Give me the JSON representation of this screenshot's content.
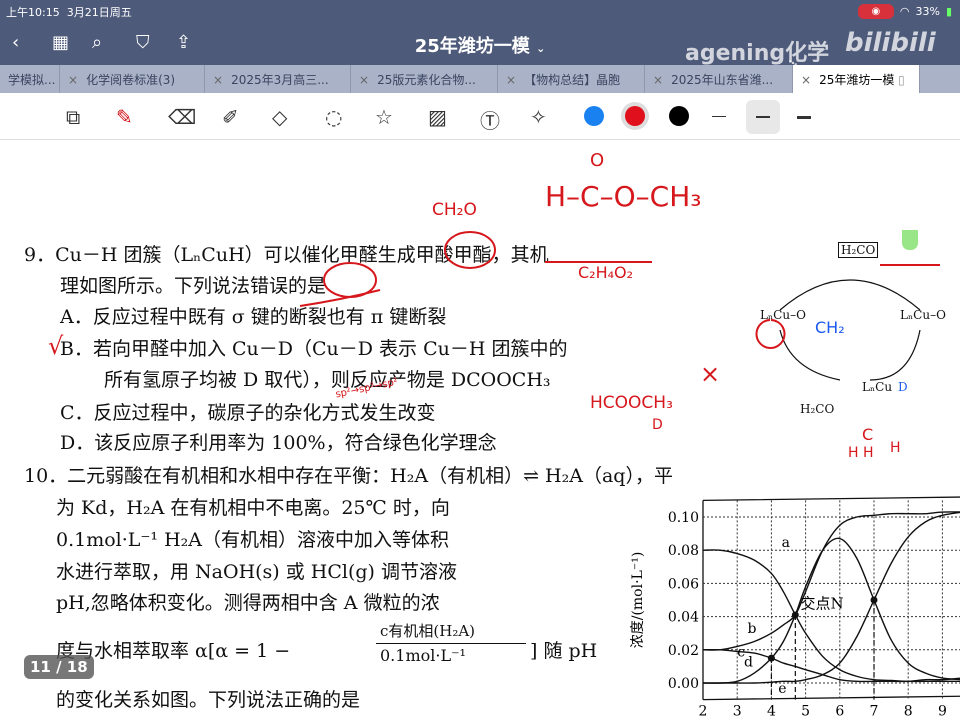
{
  "status": {
    "time": "上午10:15",
    "date": "3月21日周五",
    "battery": "33%"
  },
  "nav": {
    "title": "25年潍坊一模",
    "watermark": "ageningֻ化学",
    "watermark2": "bilibili"
  },
  "tabs": [
    {
      "label": "学模拟..."
    },
    {
      "label": "化学阅卷标准(3)"
    },
    {
      "label": "2025年3月高三..."
    },
    {
      "label": "25版元素化合物..."
    },
    {
      "label": "【物构总结】晶胞"
    },
    {
      "label": "2025年山东省潍..."
    },
    {
      "label": "25年潍坊一模"
    }
  ],
  "toolbar": {
    "colors": [
      "#1a82f0",
      "#e0101c",
      "#000000"
    ]
  },
  "doc": {
    "q9": [
      "9．Cu－H 团簇（LₙCuH）可以催化甲醛生成甲酸甲酯，其机",
      "理如图所示。下列说法错误的是"
    ],
    "q9A": "A．反应过程中既有 σ 键的断裂也有 π 键断裂",
    "q9B": [
      "B．若向甲醛中加入 Cu－D（Cu－D 表示 Cu－H 团簇中的",
      "所有氢原子均被 D 取代），则反应产物是 DCOOCH₃"
    ],
    "q9C": "C．反应过程中，碳原子的杂化方式发生改变",
    "q9D": "D．该反应原子利用率为 100%，符合绿色化学理念",
    "q10": [
      "10．二元弱酸在有机相和水相中存在平衡：H₂A（有机相）⇌ H₂A（aq），平",
      "为 Kd，H₂A 在有机相中不电离。25℃ 时，向",
      "0.1mol·L⁻¹ H₂A（有机相）溶液中加入等体积",
      "水进行萃取，用 NaOH(s) 或 HCl(g) 调节溶液",
      "pH,忽略体积变化。测得两相中含 A 微粒的浓",
      "度与水相萃取率 α[α = 1 −",
      "c有机相(H₂A)",
      "0.1mol·L⁻¹",
      "] 随 pH",
      "的变化关系如图。下列说法正确的是"
    ],
    "mech": [
      "H₂CO",
      "LₙCu–O",
      "LₙCu–O",
      "LₙCu",
      "H₂CO",
      "D"
    ],
    "page": "11 / 18"
  },
  "annotations": [
    "CH₂O",
    "H–C–O–CH₃",
    "C₂H₄O₂",
    "HCOOCH₃",
    "sp²→sp³→sp²",
    "CH₂",
    "D",
    "H",
    "O",
    "C",
    "H  H",
    "×",
    "√"
  ],
  "chart_data": {
    "type": "line",
    "xlabel": "",
    "ylabel": "浓度/(mol·L⁻¹)",
    "xlim": [
      2,
      9.6
    ],
    "ylim": [
      -0.01,
      0.11
    ],
    "xticks": [
      "2",
      "3",
      "4",
      "5",
      "6",
      "7",
      "8",
      "9"
    ],
    "yticks": [
      "0.10",
      "0.08",
      "0.06",
      "0.04",
      "0.02",
      "0.00"
    ],
    "grid": true,
    "x": [
      2,
      2.5,
      3,
      3.5,
      4,
      4.35,
      4.7,
      5,
      5.5,
      6,
      6.5,
      7,
      7.5,
      8,
      8.5,
      9,
      9.6
    ],
    "series": [
      {
        "name": "a",
        "values": [
          0.08,
          0.08,
          0.078,
          0.074,
          0.066,
          0.055,
          0.041,
          0.03,
          0.016,
          0.008,
          0.004,
          0.002,
          0.0015,
          0.001,
          0.001,
          0.001,
          0.001
        ]
      },
      {
        "name": "b",
        "values": [
          0.02,
          0.02,
          0.022,
          0.025,
          0.03,
          0.035,
          0.041,
          0.055,
          0.08,
          0.095,
          0.1,
          0.101,
          0.102,
          0.102,
          0.102,
          0.103,
          0.103
        ]
      },
      {
        "name": "c",
        "values": [
          0.02,
          0.02,
          0.019,
          0.018,
          0.015,
          0.012,
          0.01,
          0.008,
          0.005,
          0.002,
          0.001,
          0.001,
          0.001,
          0.001,
          0.002,
          0.002,
          0.003
        ]
      },
      {
        "name": "d",
        "values": [
          0,
          0,
          0.001,
          0.006,
          0.015,
          0.025,
          0.041,
          0.058,
          0.08,
          0.087,
          0.075,
          0.05,
          0.026,
          0.012,
          0.006,
          0.003,
          0.002
        ]
      },
      {
        "name": "e",
        "values": [
          0,
          0,
          0,
          0,
          0.0005,
          0.001,
          0.001,
          0.002,
          0.005,
          0.012,
          0.028,
          0.05,
          0.072,
          0.088,
          0.097,
          0.101,
          0.103
        ]
      }
    ],
    "annotations": [
      "交点N"
    ],
    "points": [
      {
        "x": 4,
        "y": 0.015
      },
      {
        "x": 4.7,
        "y": 0.041
      },
      {
        "x": 7,
        "y": 0.05
      }
    ]
  }
}
